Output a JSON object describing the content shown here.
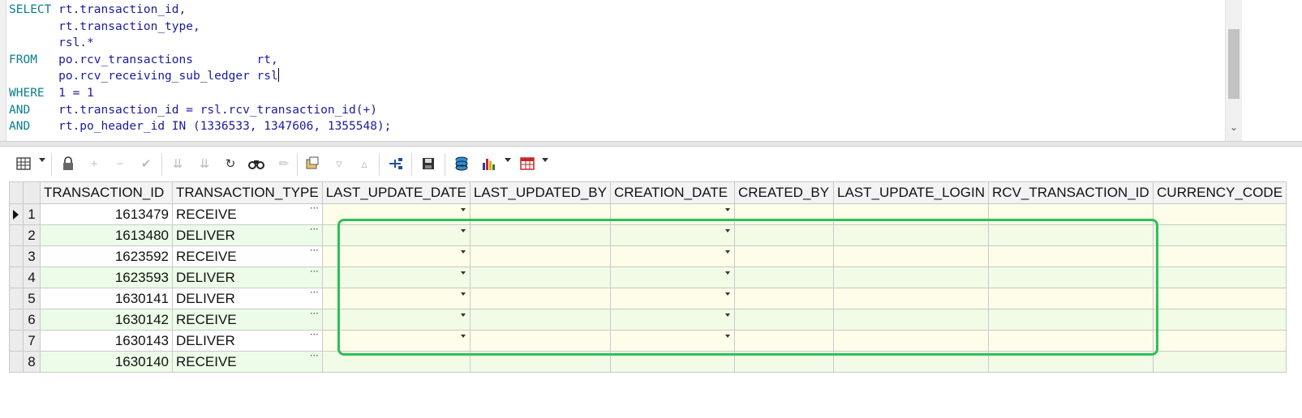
{
  "editor": {
    "lines": [
      {
        "kw": "SELECT ",
        "code": "rt.transaction_id,"
      },
      {
        "kw": "       ",
        "code": "rt.transaction_type,"
      },
      {
        "kw": "       ",
        "code": "rsl.*"
      },
      {
        "kw": "FROM   ",
        "code": "po.rcv_transactions         rt,"
      },
      {
        "kw": "       ",
        "code": "po.rcv_receiving_sub_ledger rsl"
      },
      {
        "kw": "WHERE  ",
        "code": "1 = 1"
      },
      {
        "kw": "AND    ",
        "code": "rt.transaction_id = rsl.rcv_transaction_id(+)"
      },
      {
        "kw": "AND    ",
        "code": "rt.po_header_id IN (1336533, 1347606, 1355548);"
      }
    ]
  },
  "toolbar": {
    "icons": [
      "grid-options-icon",
      "lock-icon",
      "add-record-icon",
      "delete-record-icon",
      "post-changes-icon",
      "fetch-next-icon",
      "fetch-last-icon",
      "refresh-icon",
      "find-icon",
      "clear-icon",
      "query-by-example-icon",
      "sort-descending-icon",
      "sort-ascending-icon",
      "export-tree-icon",
      "save-icon",
      "db-icon",
      "chart-icon",
      "table-view-icon"
    ]
  },
  "grid": {
    "columns": [
      "TRANSACTION_ID",
      "TRANSACTION_TYPE",
      "LAST_UPDATE_DATE",
      "LAST_UPDATED_BY",
      "CREATION_DATE",
      "CREATED_BY",
      "LAST_UPDATE_LOGIN",
      "RCV_TRANSACTION_ID",
      "CURRENCY_CODE"
    ],
    "rows": [
      {
        "n": "1",
        "id": "1613479",
        "type": "RECEIVE"
      },
      {
        "n": "2",
        "id": "1613480",
        "type": "DELIVER"
      },
      {
        "n": "3",
        "id": "1623592",
        "type": "RECEIVE"
      },
      {
        "n": "4",
        "id": "1623593",
        "type": "DELIVER"
      },
      {
        "n": "5",
        "id": "1630141",
        "type": "DELIVER"
      },
      {
        "n": "6",
        "id": "1630142",
        "type": "RECEIVE"
      },
      {
        "n": "7",
        "id": "1630143",
        "type": "DELIVER"
      },
      {
        "n": "8",
        "id": "1630140",
        "type": "RECEIVE"
      }
    ]
  },
  "highlight_color": "#2cc158"
}
